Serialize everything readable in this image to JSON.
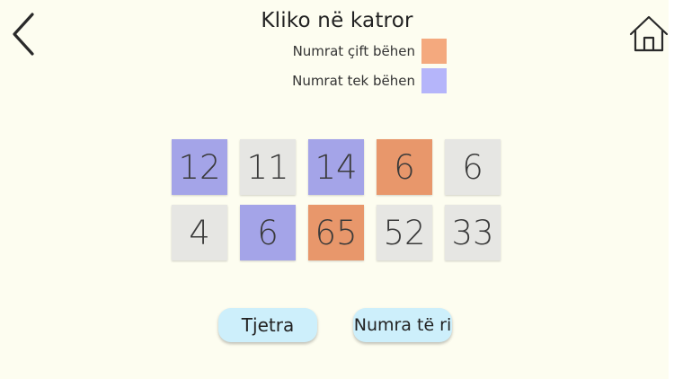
{
  "header": {
    "title": "Kliko në katror",
    "back_icon": "chevron-left-icon",
    "home_icon": "home-icon"
  },
  "legend": {
    "even_label": "Numrat çift bëhen",
    "even_color": "#f4a97e",
    "odd_label": "Numrat tek bëhen",
    "odd_color": "#b5b5fa"
  },
  "grid": {
    "cells": [
      {
        "value": "12",
        "color": "#a4a4e8"
      },
      {
        "value": "11",
        "color": "#e6e6e3"
      },
      {
        "value": "14",
        "color": "#a4a4e8"
      },
      {
        "value": "6",
        "color": "#e8976b"
      },
      {
        "value": "6",
        "color": "#e6e6e3"
      },
      {
        "value": "4",
        "color": "#e6e6e3"
      },
      {
        "value": "6",
        "color": "#a4a4e8"
      },
      {
        "value": "65",
        "color": "#e8976b"
      },
      {
        "value": "52",
        "color": "#e6e6e3"
      },
      {
        "value": "33",
        "color": "#e6e6e3"
      }
    ]
  },
  "buttons": {
    "next_label": "Tjetra",
    "new_numbers_label": "Numra të ri",
    "button_color": "#cdeffb"
  }
}
